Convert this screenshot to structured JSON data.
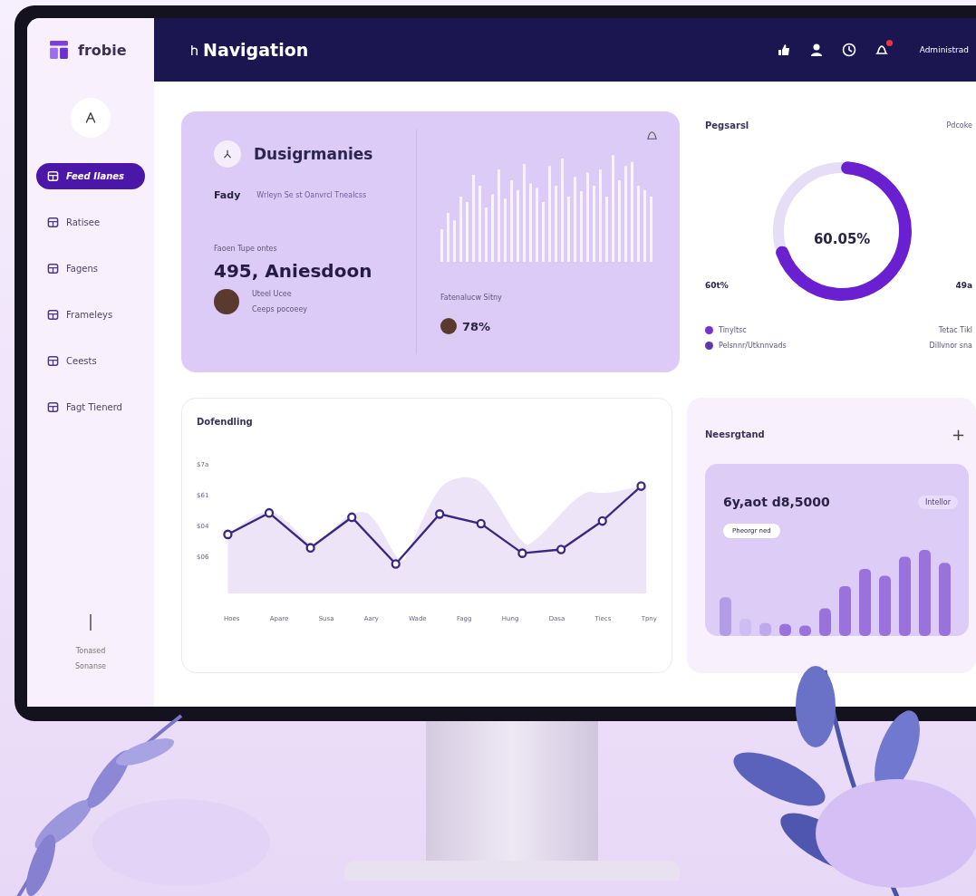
{
  "brand": {
    "name": "frobie"
  },
  "header": {
    "title": "Navigation",
    "user": "Administrad",
    "notification": true
  },
  "sidebar": {
    "items": [
      {
        "label": "Feed Ilanes",
        "selected": true
      },
      {
        "label": "Ratisee",
        "selected": false
      },
      {
        "label": "Fagens",
        "selected": false
      },
      {
        "label": "Frameleys",
        "selected": false
      },
      {
        "label": "Ceests",
        "selected": false
      },
      {
        "label": "Fagt Tienerd",
        "selected": false
      }
    ],
    "footer": [
      "Tonased",
      "Sonanse"
    ]
  },
  "summary_card": {
    "title": "Dusigrmanies",
    "tag": "Fady",
    "subtitle": "Wrleyn Se st Oanvrcl Tnealcss",
    "stat_label": "Faoen Tupe ontes",
    "stat_value": "495, Aniesdoon",
    "person_lines": [
      "Uteel Ucee",
      "Ceeps pocoeey"
    ],
    "rate_label": "Fatenalucw Sitny",
    "rate_value": "78%"
  },
  "progress_card": {
    "title": "Pegsarsl",
    "corner": "Pdcoke",
    "level": 0.68,
    "center": "60.05%",
    "left_value": "60t%",
    "right_value": "49a",
    "legend": [
      {
        "label": "Tinyltsc",
        "color": "#7a2fd0"
      },
      {
        "label": "Pelsnnr/Utknnvads",
        "color": "#5a3aa8"
      }
    ],
    "notes": [
      "Tetac Tikl",
      "Dillvnor sna"
    ]
  },
  "trend_card": {
    "title": "Dofendling",
    "y_labels": [
      "$7a",
      "$61",
      "$04",
      "$06"
    ],
    "x_labels": [
      "Hoes",
      "Apare",
      "Susa",
      "Aary",
      "Wade",
      "Fagg",
      "Hung",
      "Dasa",
      "Tiecs",
      "Tpny"
    ]
  },
  "balance_card": {
    "title": "Neesrgtand",
    "add": "+",
    "amount": "6y,aot d8,5000",
    "chip": "Intellor",
    "pill": "Pheorgr ned"
  }
}
